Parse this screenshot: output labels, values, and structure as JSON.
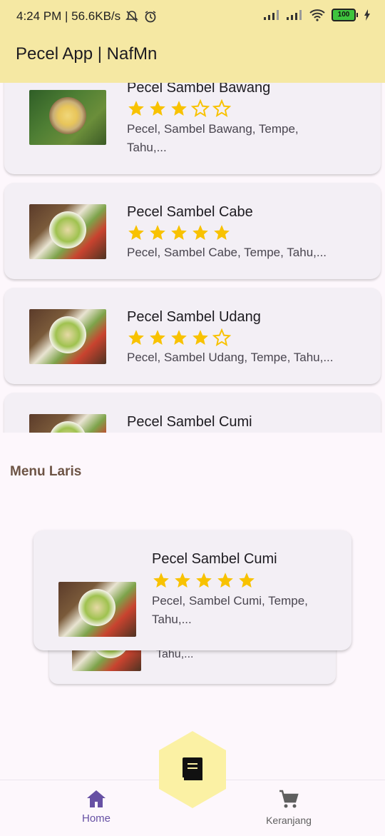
{
  "status_bar": {
    "time_speed": "4:24 PM | 56.6KB/s",
    "battery": "100"
  },
  "app": {
    "title": "Pecel App | NafMn"
  },
  "menu_list": [
    {
      "title": "Pecel Sambel Bawang",
      "rating": 3,
      "desc_line1": "Pecel, Sambel Bawang, Tempe,",
      "desc_line2": "Tahu,..."
    },
    {
      "title": "Pecel Sambel Cabe",
      "rating": 5,
      "desc_line1": "Pecel, Sambel Cabe, Tempe, Tahu,...",
      "desc_line2": ""
    },
    {
      "title": "Pecel Sambel Udang",
      "rating": 4,
      "desc_line1": "Pecel, Sambel Udang, Tempe, Tahu,...",
      "desc_line2": ""
    },
    {
      "title": "Pecel Sambel Cumi",
      "rating": null,
      "desc_line1": "",
      "desc_line2": ""
    }
  ],
  "section": {
    "title": "Menu Laris"
  },
  "carousel": {
    "back_card_desc": "Tahu,...",
    "featured": {
      "title": "Pecel Sambel Cumi",
      "rating": 5,
      "desc_line1": "Pecel, Sambel Cumi, Tempe,",
      "desc_line2": "Tahu,..."
    }
  },
  "bottom_nav": {
    "home_label": "Home",
    "cart_label": "Keranjang",
    "center_icon": "menu-book-icon"
  },
  "colors": {
    "app_bar": "#f5e8a3",
    "star": "#f8c200",
    "nav_active": "#6750a4",
    "section_title": "#6d5445"
  }
}
